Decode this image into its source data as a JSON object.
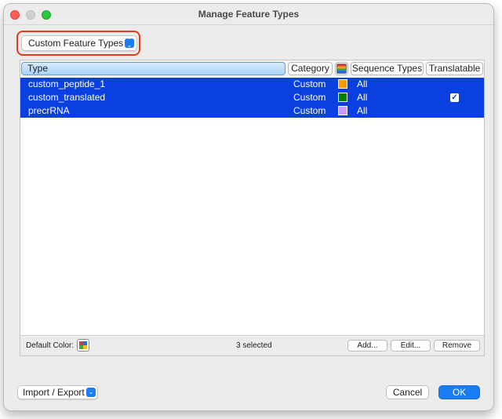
{
  "window": {
    "title": "Manage Feature Types"
  },
  "filter": {
    "selected": "Custom Feature Types"
  },
  "table": {
    "columns": {
      "type": "Type",
      "category": "Category",
      "sequence_types": "Sequence Types",
      "translatable": "Translatable"
    },
    "rows": [
      {
        "type": "custom_peptide_1",
        "category": "Custom",
        "color": "#ff9900",
        "sequence_types": "All",
        "translatable": false
      },
      {
        "type": "custom_translated",
        "category": "Custom",
        "color": "#007f00",
        "sequence_types": "All",
        "translatable": true
      },
      {
        "type": "precrRNA",
        "category": "Custom",
        "color": "#cc99ff",
        "sequence_types": "All",
        "translatable": false
      }
    ]
  },
  "footer": {
    "default_color_label": "Default Color:",
    "selected_count": "3 selected",
    "add_label": "Add...",
    "edit_label": "Edit...",
    "remove_label": "Remove"
  },
  "bottom": {
    "import_export_label": "Import / Export",
    "cancel_label": "Cancel",
    "ok_label": "OK"
  },
  "colors": {
    "selection": "#0a3fe0",
    "accent": "#1a7cf5",
    "highlight_ring": "#e63b1f"
  }
}
